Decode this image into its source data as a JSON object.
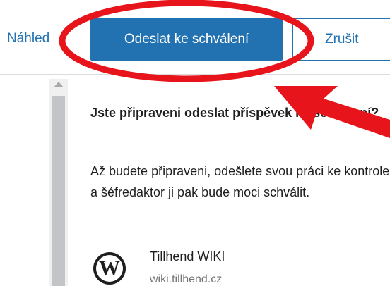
{
  "toolbar": {
    "preview_label": "Náhled",
    "submit_label": "Odeslat ke schválení",
    "cancel_label": "Zrušit"
  },
  "panel": {
    "question": "Jste připraveni odeslat příspěvek ke schválení?",
    "description": "Až budete připraveni, odešlete svou práci ke kontrole a šéfredaktor ji pak bude moci schválit.",
    "site": {
      "name": "Tillhend WIKI",
      "url": "wiki.tillhend.cz",
      "logo_glyph": "W",
      "logo_icon": "wordpress-logo-icon"
    }
  },
  "colors": {
    "primary": "#2271b1",
    "annotation": "#e8141b"
  }
}
